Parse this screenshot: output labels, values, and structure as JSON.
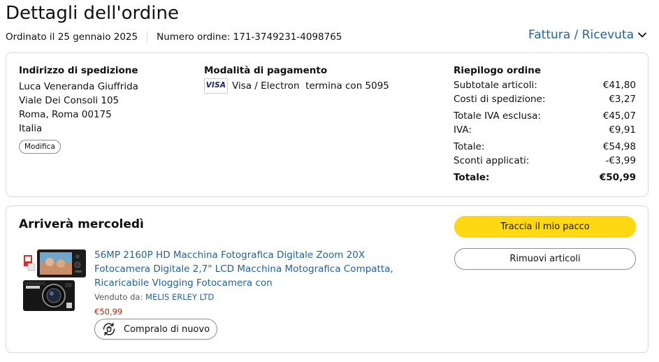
{
  "header": {
    "title": "Dettagli dell'ordine",
    "ordered_on": "Ordinato il 25 gennaio 2025",
    "order_number": "Numero ordine: 171-3749231-4098765",
    "invoice_link": "Fattura / Ricevuta"
  },
  "shipping": {
    "heading": "Indirizzo di spedizione",
    "lines": [
      "Luca Veneranda Giuffrida",
      "Viale Dei Consoli 105",
      "Roma, Roma 00175",
      "Italia"
    ],
    "edit_label": "Modifica"
  },
  "payment": {
    "heading": "Modalità di pagamento",
    "card_logo": "VISA",
    "card_text": "Visa / Electron  termina con 5095"
  },
  "summary": {
    "heading": "Riepilogo ordine",
    "rows": [
      {
        "label": "Subtotale articoli:",
        "value": "€41,80"
      },
      {
        "label": "Costi di spedizione:",
        "value": "€3,27"
      },
      {
        "label": "Totale IVA esclusa:",
        "value": "€45,07"
      },
      {
        "label": "IVA:",
        "value": "€9,91"
      },
      {
        "label": "Totale:",
        "value": "€54,98"
      },
      {
        "label": "Sconti applicati:",
        "value": "-€3,99"
      },
      {
        "label": "Totale:",
        "value": "€50,99"
      }
    ]
  },
  "delivery": {
    "heading": "Arriverà mercoledì",
    "track_button": "Traccia il mio pacco",
    "remove_button": "Rimuovi articoli"
  },
  "product": {
    "title": "56MP 2160P HD Macchina Fotografica Digitale Zoom 20X Fotocamera Digitale 2,7\" LCD Macchina Motografica Compatta, Ricaricabile Vlogging Fotocamera con",
    "sold_by_label": "Venduto da:",
    "seller": "MELIS ERLEY LTD",
    "price": "€50,99",
    "rebuy_button": "Compralo di nuovo"
  },
  "colors": {
    "link": "#2162a1",
    "price": "#b12704",
    "track_button": "#ffd814"
  }
}
